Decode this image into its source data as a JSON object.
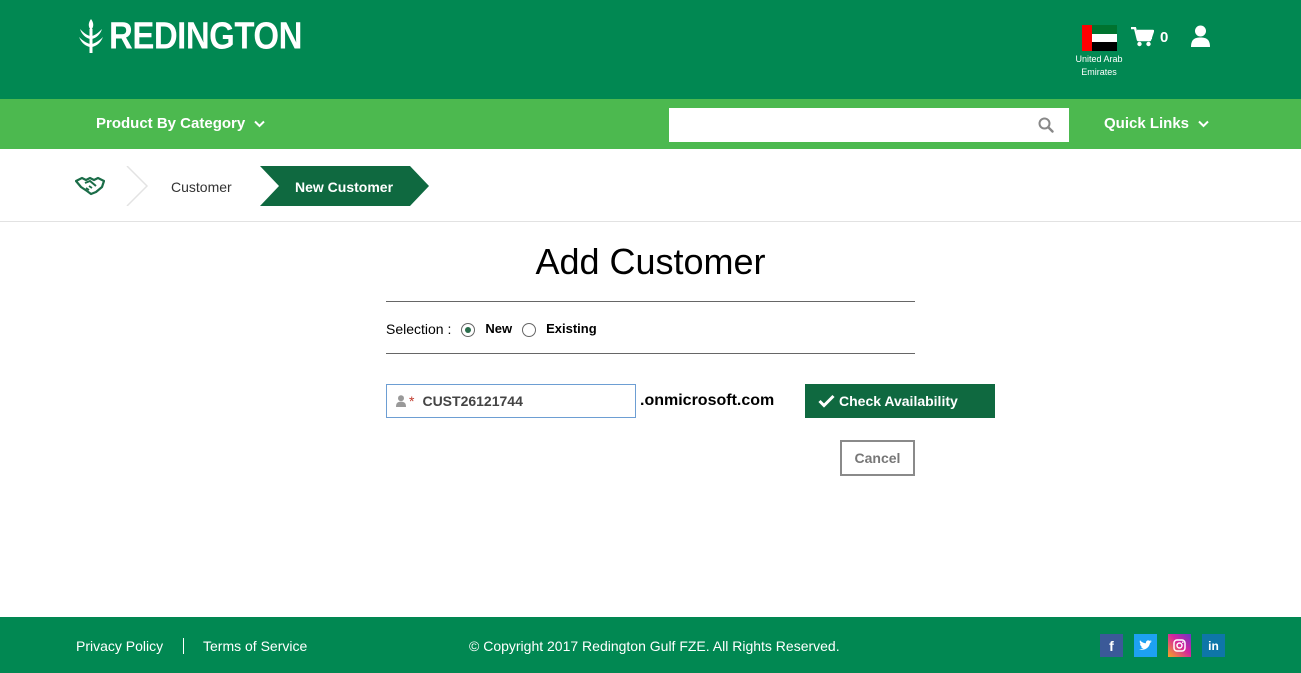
{
  "header": {
    "brand": "REDINGTON",
    "country": "United Arab Emirates",
    "cart_count": "0"
  },
  "nav": {
    "category_label": "Product By Category",
    "search_placeholder": "",
    "quick_links_label": "Quick Links"
  },
  "breadcrumb": {
    "items": [
      "Customer",
      "New Customer"
    ]
  },
  "form": {
    "title": "Add Customer",
    "selection_label": "Selection :",
    "options": [
      "New",
      "Existing"
    ],
    "selected_option": "New",
    "domain_value": "CUST26121744",
    "domain_suffix": ".onmicrosoft.com",
    "check_button": "Check Availability",
    "cancel_button": "Cancel"
  },
  "footer": {
    "privacy": "Privacy Policy",
    "terms": "Terms of Service",
    "copyright": "© Copyright 2017 Redington Gulf FZE. All Rights Reserved.",
    "social": [
      "facebook",
      "twitter",
      "instagram",
      "linkedin"
    ]
  },
  "colors": {
    "header_green": "#018852",
    "nav_green": "#4cb94f",
    "button_green": "#0f6940"
  }
}
